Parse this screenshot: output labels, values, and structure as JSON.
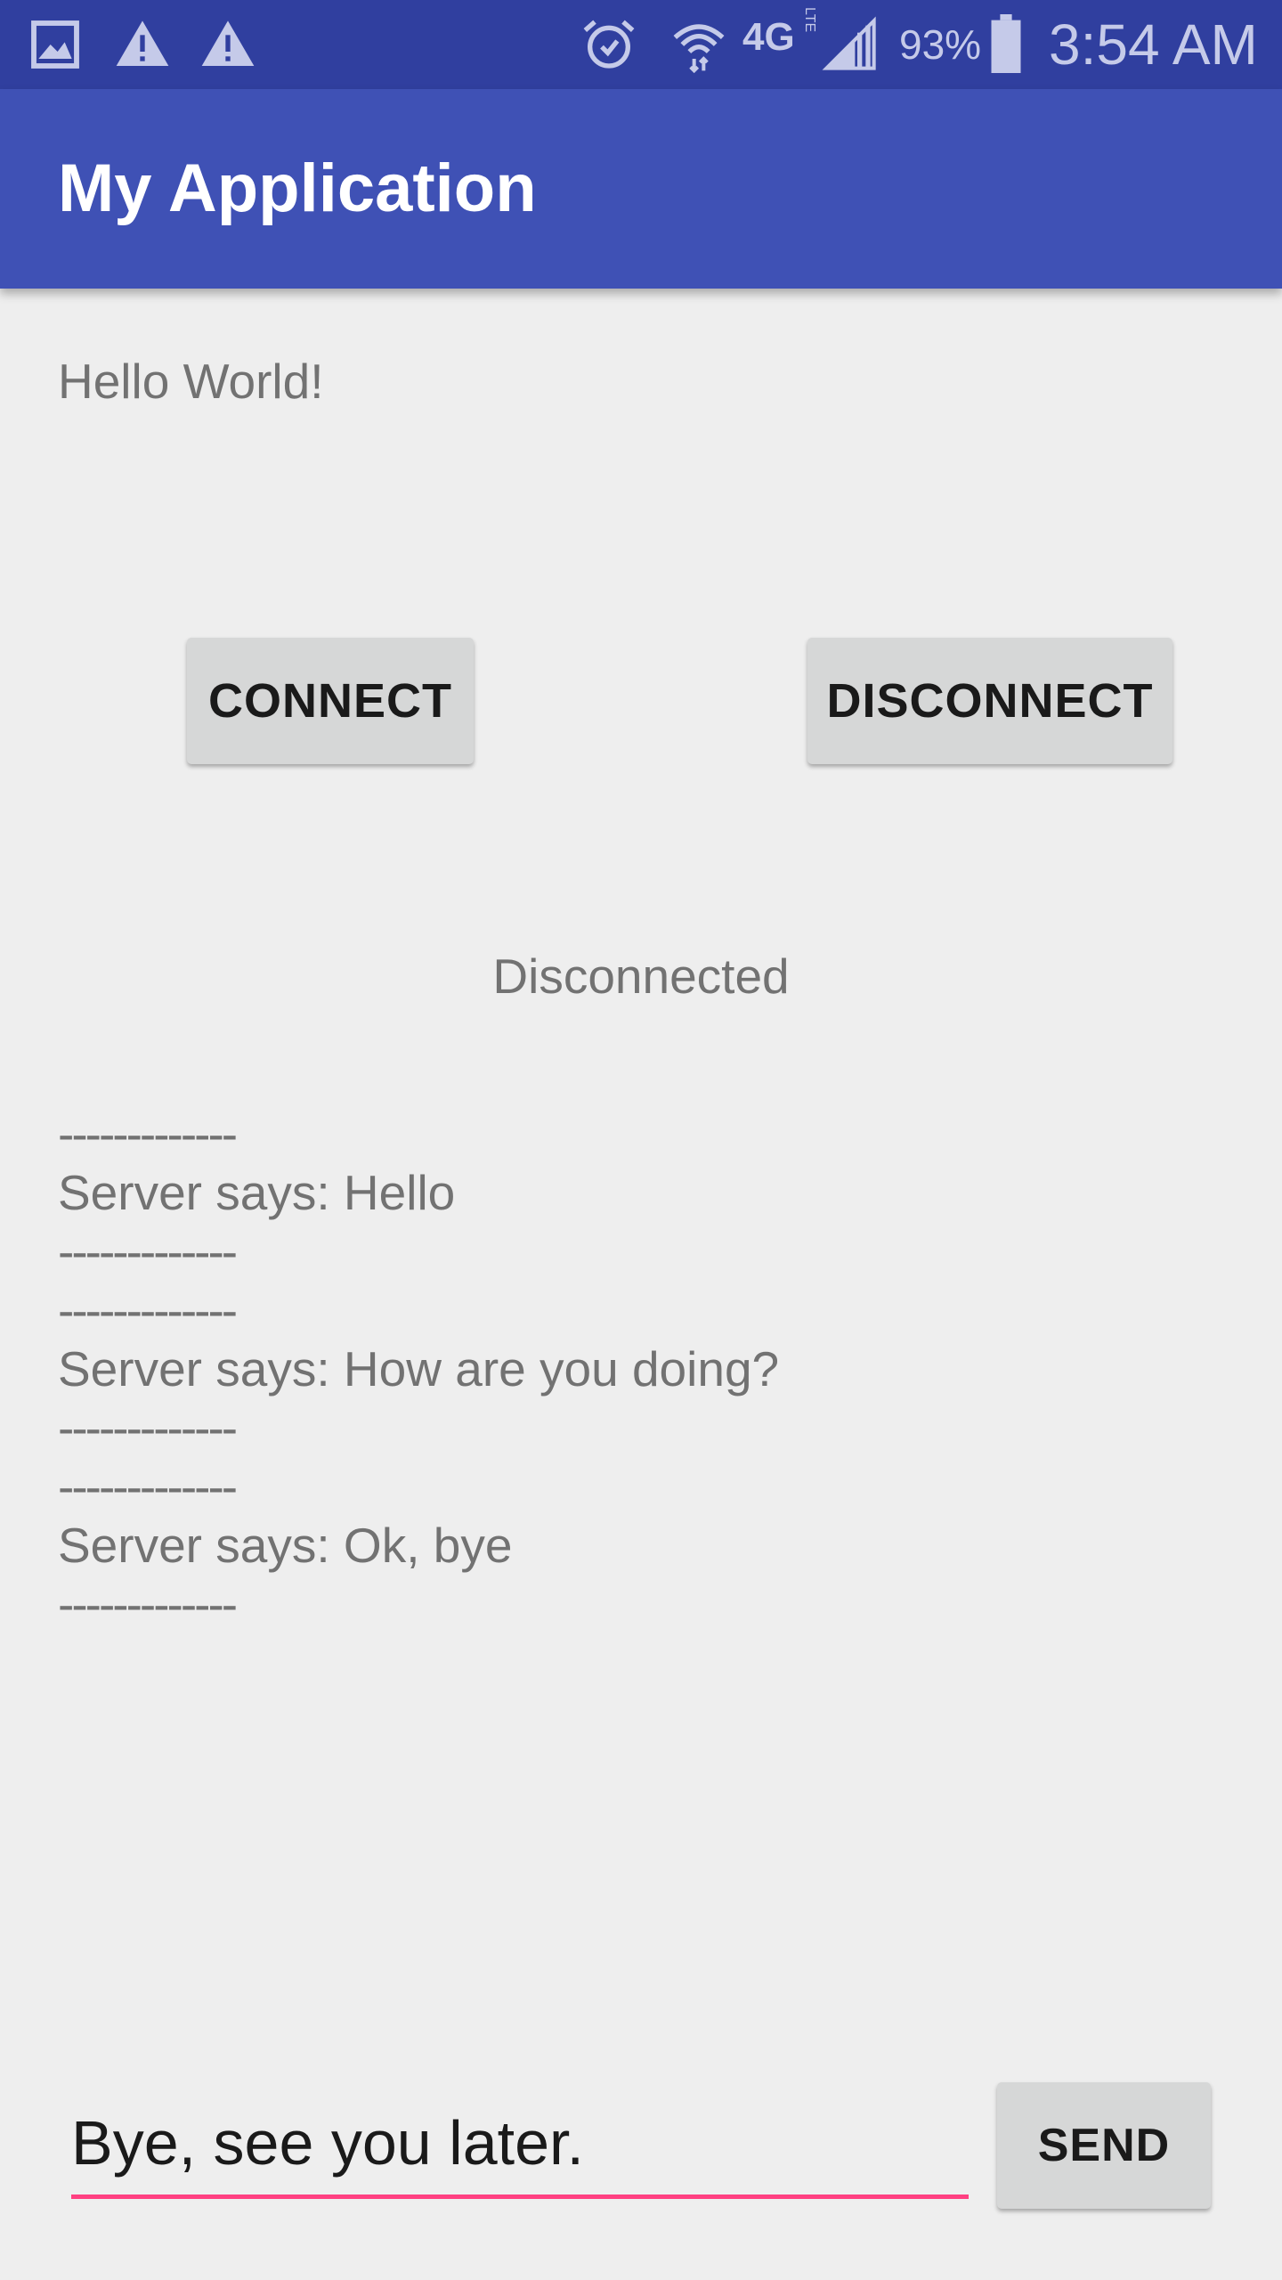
{
  "status_bar": {
    "battery": "93%",
    "time": "3:54 AM",
    "network": "4G",
    "network_sub": "LTE",
    "icons_left": [
      "gallery-icon",
      "warning-icon",
      "warning-icon"
    ],
    "icons_right": [
      "alarm-icon",
      "wifi-icon",
      "signal-icon",
      "battery-icon"
    ],
    "color": "#303f9f"
  },
  "app_bar": {
    "title": "My Application",
    "color": "#3f51b5"
  },
  "main": {
    "greeting": "Hello World!",
    "connect_label": "CONNECT",
    "disconnect_label": "DISCONNECT",
    "connection_status": "Disconnected",
    "log": [
      "-------------",
      "Server says: Hello",
      "-------------",
      "-------------",
      "Server says: How are you doing?",
      "-------------",
      "-------------",
      "Server says: Ok, bye",
      "-------------"
    ]
  },
  "composer": {
    "value": "Bye, see you later.",
    "send_label": "SEND",
    "accent_color": "#ff4081"
  }
}
